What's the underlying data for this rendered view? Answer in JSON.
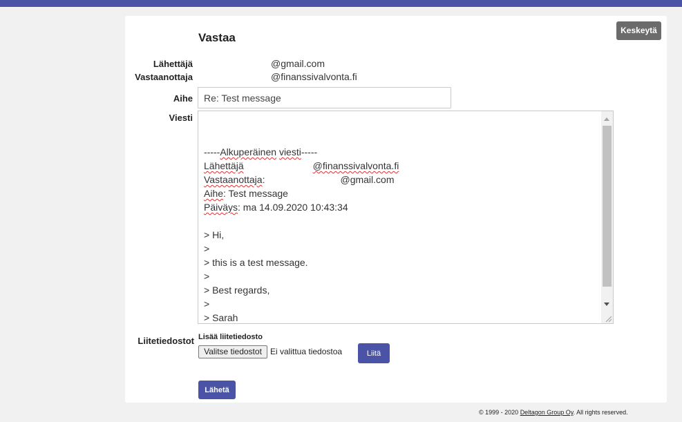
{
  "form": {
    "title": "Vastaa",
    "cancel_label": "Keskeytä",
    "sender_label": "Lähettäjä",
    "sender_value": "@gmail.com",
    "recipient_label": "Vastaanottaja",
    "recipient_value": "@finanssivalvonta.fi",
    "subject_label": "Aihe",
    "subject_value": "Re: Test message",
    "message_label": "Viesti",
    "message": {
      "sep_pre": "-----",
      "sep_w1": "Alkuperäinen",
      "sep_mid": " ",
      "sep_w2": "viesti",
      "sep_post": "-----",
      "from_key": "Lähettäjä",
      "from_value": "@finanssivalvonta.fi",
      "to_key": "Vastaanottaja",
      "to_colon": ":",
      "to_value": "@gmail.com",
      "subject_key": "Aihe",
      "subject_rest": ": Test message",
      "date_key": "Päiväys",
      "date_rest": ": ma 14.09.2020 10:43:34",
      "quote_lines": [
        "> Hi,",
        ">",
        "> this is a test message.",
        ">",
        "> Best regards,",
        ">",
        "> Sarah"
      ]
    },
    "attachments_label": "Liitetiedostot",
    "add_attachment_label": "Lisää liitetiedosto",
    "choose_files_label": "Valitse tiedostot",
    "no_file_text": "Ei valittua tiedostoa",
    "attach_label": "Liitä",
    "send_label": "Lähetä"
  },
  "footer": {
    "prefix": "© 1999 - 2020 ",
    "company": "Deltagon Group Oy",
    "suffix": ". All rights reserved."
  },
  "colors": {
    "accent": "#4a53a5",
    "cancel": "#6b6b6b",
    "background": "#f1f1f1"
  }
}
